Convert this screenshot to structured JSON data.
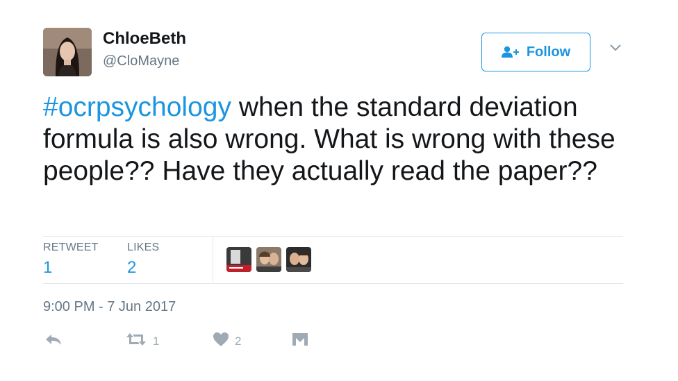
{
  "user": {
    "display_name": "ChloeBeth",
    "handle": "@CloMayne"
  },
  "follow_button": {
    "label": "Follow",
    "icon": "add-user-icon"
  },
  "tweet": {
    "hashtag": "#ocrpsychology",
    "text": " when the standard deviation formula is also wrong. What is wrong with these people?? Have they actually read the paper??"
  },
  "stats": {
    "retweets_label": "RETWEET",
    "retweets_count": "1",
    "likes_label": "LIKES",
    "likes_count": "2"
  },
  "timestamp": "9:00 PM - 7 Jun 2017",
  "actions": {
    "reply_icon": "reply-icon",
    "retweet_icon": "retweet-icon",
    "retweet_count": "1",
    "like_icon": "heart-icon",
    "like_count": "2",
    "dm_icon": "direct-message-icon"
  },
  "colors": {
    "accent": "#1b95e0",
    "text": "#14171a",
    "muted": "#657786",
    "divider": "#e1e8ed",
    "action_icon": "#a0aab4"
  }
}
